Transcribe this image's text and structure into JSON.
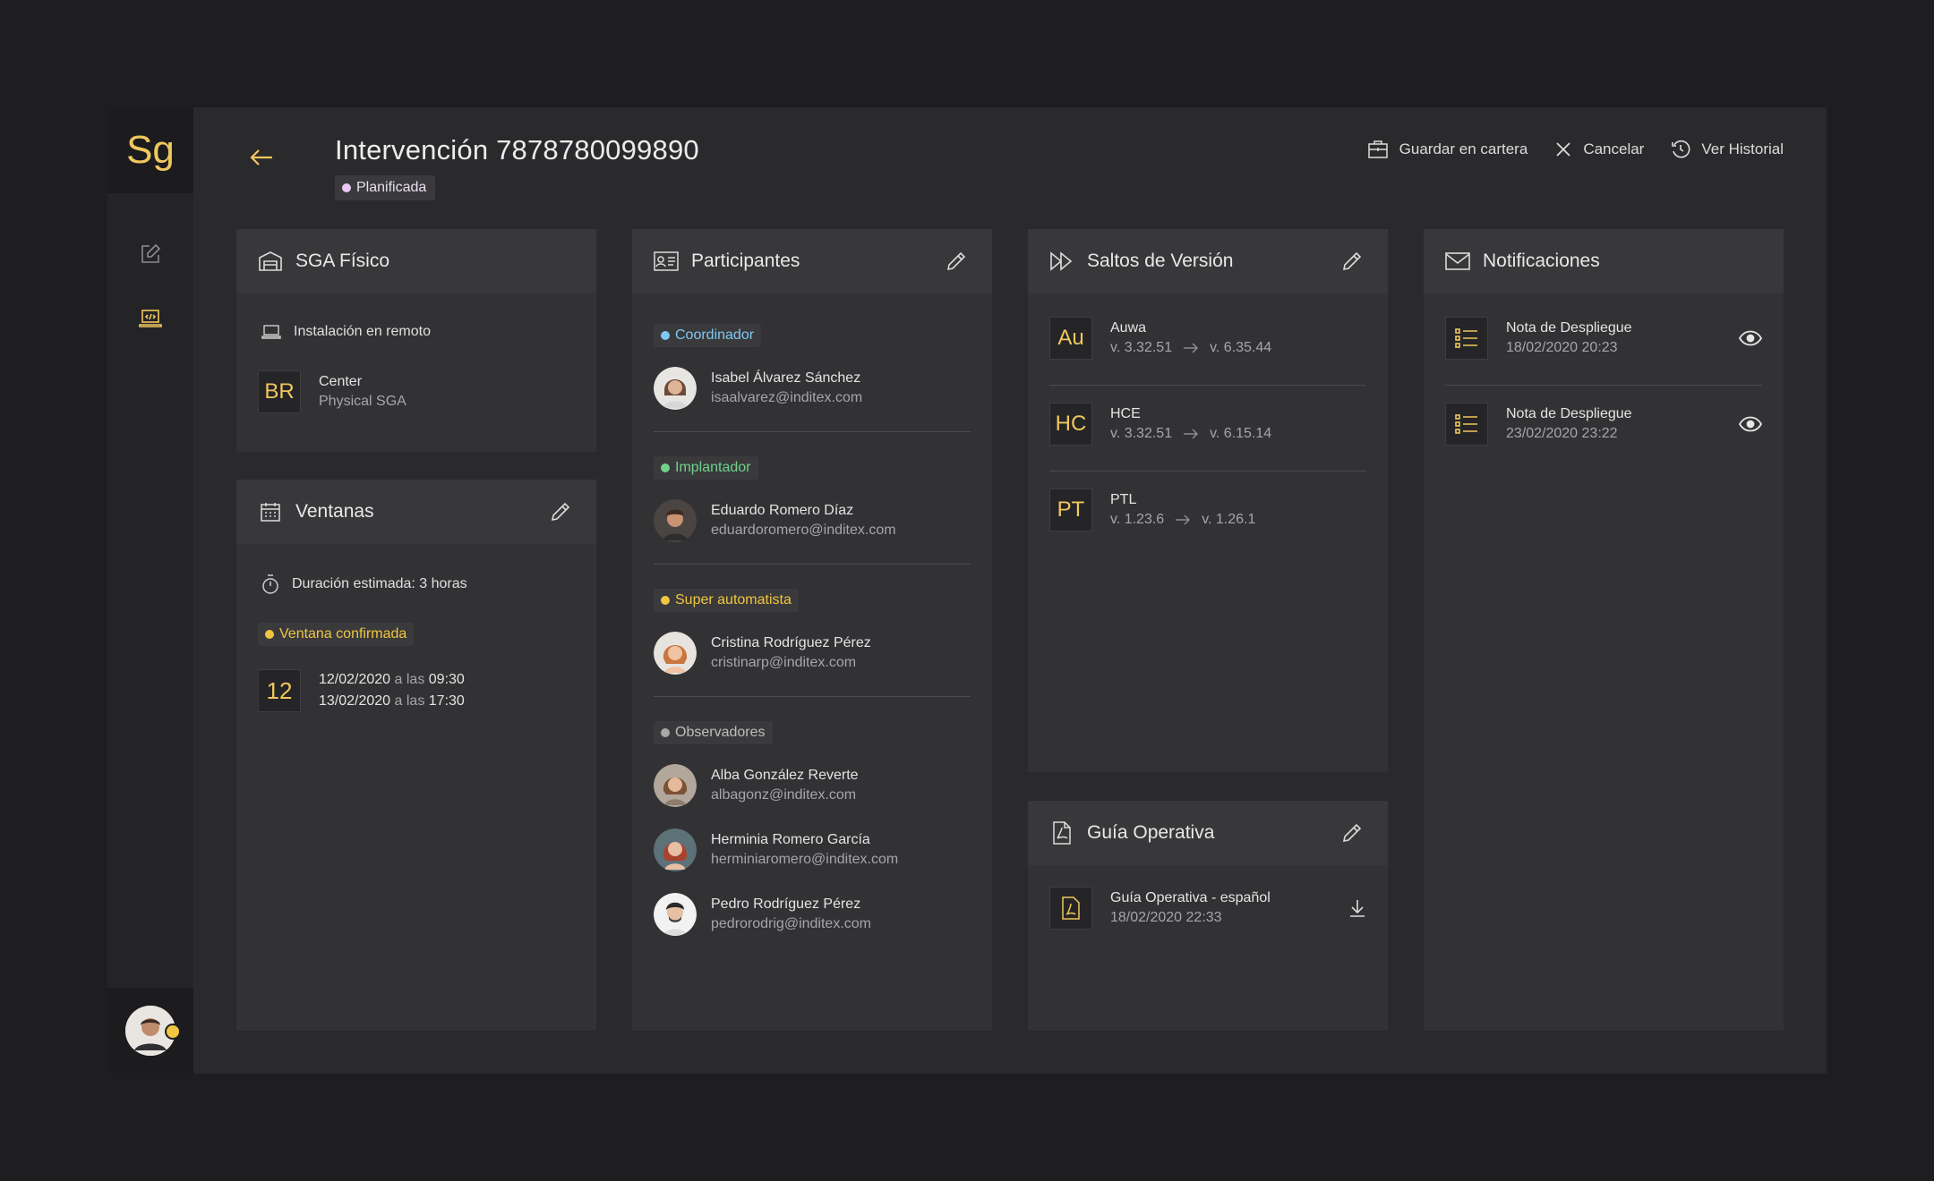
{
  "app": {
    "logo": "Sg"
  },
  "header": {
    "title": "Intervención 7878780099890",
    "status": "Planificada",
    "actions": {
      "save": "Guardar en cartera",
      "cancel": "Cancelar",
      "history": "Ver Historial"
    }
  },
  "sga": {
    "title": "SGA Físico",
    "install": "Instalación en remoto",
    "tile": "BR",
    "name": "Center",
    "sub": "Physical SGA"
  },
  "ventanas": {
    "title": "Ventanas",
    "duration": "Duración estimada: 3 horas",
    "status": "Ventana confirmada",
    "day": "12",
    "start_date": "12/02/2020",
    "start_time": "09:30",
    "end_date": "13/02/2020",
    "end_time": "17:30",
    "connector": "a las"
  },
  "participantes": {
    "title": "Participantes",
    "groups": [
      {
        "role": "Coordinador",
        "color": "#7ec8f0",
        "people": [
          {
            "name": "Isabel Álvarez Sánchez",
            "email": "isaalvarez@inditex.com"
          }
        ]
      },
      {
        "role": "Implantador",
        "color": "#6fd38a",
        "people": [
          {
            "name": "Eduardo Romero Díaz",
            "email": "eduardoromero@inditex.com"
          }
        ]
      },
      {
        "role": "Super automatista",
        "color": "#f0c540",
        "people": [
          {
            "name": "Cristina Rodríguez Pérez",
            "email": "cristinarp@inditex.com"
          }
        ]
      },
      {
        "role": "Observadores",
        "color": "#a9a9a9",
        "people": [
          {
            "name": "Alba González Reverte",
            "email": "albagonz@inditex.com"
          },
          {
            "name": "Herminia Romero García",
            "email": "herminiaromero@inditex.com"
          },
          {
            "name": "Pedro Rodríguez Pérez",
            "email": "pedrorodrig@inditex.com"
          }
        ]
      }
    ]
  },
  "saltos": {
    "title": "Saltos de Versión",
    "items": [
      {
        "tile": "Au",
        "name": "Auwa",
        "from": "v. 3.32.51",
        "to": "v. 6.35.44"
      },
      {
        "tile": "HC",
        "name": "HCE",
        "from": "v. 3.32.51",
        "to": "v. 6.15.14"
      },
      {
        "tile": "PT",
        "name": "PTL",
        "from": "v. 1.23.6",
        "to": "v. 1.26.1"
      }
    ]
  },
  "guia": {
    "title": "Guía Operativa",
    "doc_name": "Guía Operativa - español",
    "doc_date": "18/02/2020 22:33"
  },
  "notificaciones": {
    "title": "Notificaciones",
    "items": [
      {
        "name": "Nota de Despliegue",
        "date": "18/02/2020 20:23"
      },
      {
        "name": "Nota de Despliegue",
        "date": "23/02/2020 23:22"
      }
    ]
  },
  "colors": {
    "accent": "#f0c75e",
    "background": "#1e1e20",
    "panel": "#323234"
  }
}
